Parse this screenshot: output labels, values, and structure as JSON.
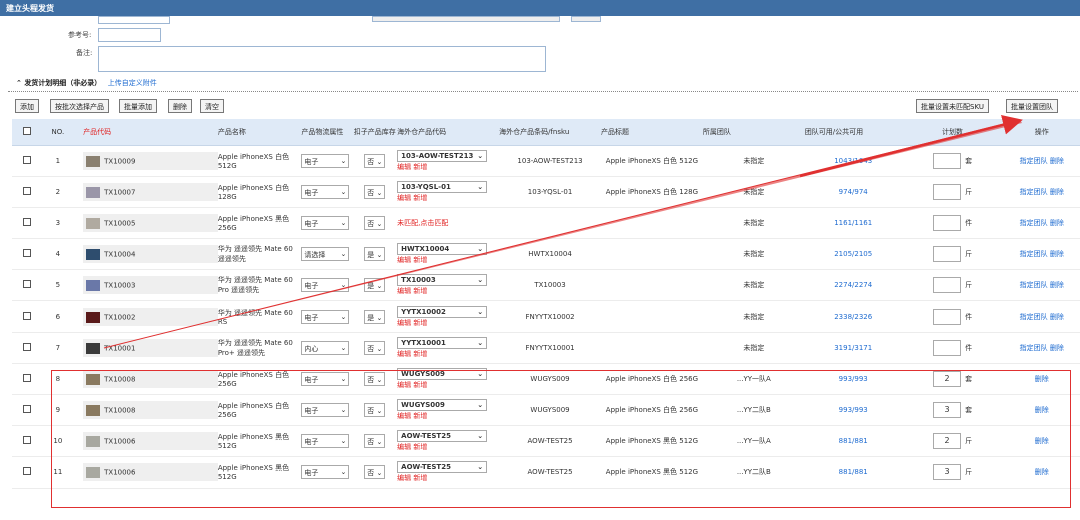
{
  "window": {
    "title": "建立头程发货"
  },
  "form": {
    "ref_label": "参考号:",
    "remark_label": "备注:"
  },
  "section": {
    "title": "发货计划明细（非必录）",
    "upload_link": "上传自定义附件"
  },
  "toolbar": {
    "add": "添加",
    "by_batch": "按批次选择产品",
    "batch_add": "批量添加",
    "delete": "删除",
    "clear": "清空",
    "batch_unmatched_sku": "批量设置未匹配SKU",
    "batch_team": "批量设置团队"
  },
  "table": {
    "headers": [
      "NO.",
      "产品代码",
      "产品名称",
      "产品物流属性",
      "扣子产品库存",
      "海外仓产品代码",
      "海外仓产品条码/fnsku",
      "产品标题",
      "所属团队",
      "团队可用/公共可用",
      "计划数",
      "操作"
    ],
    "edit_label": "编辑",
    "new_label": "新增",
    "rows": [
      {
        "no": "1",
        "code": "TX10009",
        "name": "Apple iPhoneXS 白色 512G",
        "logistics": "电子",
        "stock": "否",
        "wh_code": "103-AOW-TEST213",
        "wh_barcode": "103-AOW-TEST213",
        "title": "Apple iPhoneXS 白色 512G",
        "team": "未指定",
        "avail": "1043/1043",
        "qty": "",
        "unit": "套",
        "op1": "指定团队",
        "op2": "删除",
        "thumb": "#8a8070"
      },
      {
        "no": "2",
        "code": "TX10007",
        "name": "Apple iPhoneXS 白色 128G",
        "logistics": "电子",
        "stock": "否",
        "wh_code": "103-YQSL-01",
        "wh_barcode": "103-YQSL-01",
        "title": "Apple iPhoneXS 白色 128G",
        "team": "未指定",
        "avail": "974/974",
        "qty": "",
        "unit": "斤",
        "op1": "指定团队",
        "op2": "删除",
        "thumb": "#9a96a8"
      },
      {
        "no": "3",
        "code": "TX10005",
        "name": "Apple iPhoneXS 黑色 256G",
        "logistics": "电子",
        "stock": "否",
        "wh_code": "",
        "wh_barcode": "",
        "title": "",
        "team": "未指定",
        "avail": "1161/1161",
        "qty": "",
        "unit": "件",
        "op1": "指定团队",
        "op2": "删除",
        "thumb": "#b0aaa0",
        "unmatched": "未匹配,点击匹配"
      },
      {
        "no": "4",
        "code": "TX10004",
        "name": "华为 遥遥领先 Mate 60 遥遥领先",
        "logistics": "请选择",
        "stock": "是",
        "wh_code": "HWTX10004",
        "wh_barcode": "HWTX10004",
        "title": "",
        "team": "未指定",
        "avail": "2105/2105",
        "qty": "",
        "unit": "斤",
        "op1": "指定团队",
        "op2": "删除",
        "thumb": "#2e4d6e"
      },
      {
        "no": "5",
        "code": "TX10003",
        "name": "华为 遥遥领先 Mate 60 Pro 遥遥领先",
        "logistics": "电子",
        "stock": "是",
        "wh_code": "TX10003",
        "wh_barcode": "TX10003",
        "title": "",
        "team": "未指定",
        "avail": "2274/2274",
        "qty": "",
        "unit": "斤",
        "op1": "指定团队",
        "op2": "删除",
        "thumb": "#6a78a8"
      },
      {
        "no": "6",
        "code": "TX10002",
        "name": "华为 遥遥领先 Mate 60 RS",
        "logistics": "电子",
        "stock": "是",
        "wh_code": "YYTX10002",
        "wh_barcode": "FNYYTX10002",
        "title": "",
        "team": "未指定",
        "avail": "2338/2326",
        "qty": "",
        "unit": "件",
        "op1": "指定团队",
        "op2": "删除",
        "thumb": "#5a1a1a"
      },
      {
        "no": "7",
        "code": "TX10001",
        "name": "华为 遥遥领先 Mate 60 Pro+ 遥遥领先",
        "logistics": "内心",
        "stock": "否",
        "wh_code": "YYTX10001",
        "wh_barcode": "FNYYTX10001",
        "title": "",
        "team": "未指定",
        "avail": "3191/3171",
        "qty": "",
        "unit": "件",
        "op1": "指定团队",
        "op2": "删除",
        "thumb": "#3a3a3a"
      },
      {
        "no": "8",
        "code": "TX10008",
        "name": "Apple iPhoneXS 白色 256G",
        "logistics": "电子",
        "stock": "否",
        "wh_code": "WUGYS009",
        "wh_barcode": "WUGYS009",
        "title": "Apple iPhoneXS 白色 256G",
        "team": "...YY一队A",
        "avail": "993/993",
        "qty": "2",
        "unit": "套",
        "op1": "",
        "op2": "删除",
        "thumb": "#8a7a60"
      },
      {
        "no": "9",
        "code": "TX10008",
        "name": "Apple iPhoneXS 白色 256G",
        "logistics": "电子",
        "stock": "否",
        "wh_code": "WUGYS009",
        "wh_barcode": "WUGYS009",
        "title": "Apple iPhoneXS 白色 256G",
        "team": "...YY二队B",
        "avail": "993/993",
        "qty": "3",
        "unit": "套",
        "op1": "",
        "op2": "删除",
        "thumb": "#8a7a60"
      },
      {
        "no": "10",
        "code": "TX10006",
        "name": "Apple iPhoneXS 黑色 512G",
        "logistics": "电子",
        "stock": "否",
        "wh_code": "AOW-TEST25",
        "wh_barcode": "AOW-TEST25",
        "title": "Apple iPhoneXS 黑色 512G",
        "team": "...YY一队A",
        "avail": "881/881",
        "qty": "2",
        "unit": "斤",
        "op1": "",
        "op2": "删除",
        "thumb": "#a8a8a0"
      },
      {
        "no": "11",
        "code": "TX10006",
        "name": "Apple iPhoneXS 黑色 512G",
        "logistics": "电子",
        "stock": "否",
        "wh_code": "AOW-TEST25",
        "wh_barcode": "AOW-TEST25",
        "title": "Apple iPhoneXS 黑色 512G",
        "team": "...YY二队B",
        "avail": "881/881",
        "qty": "3",
        "unit": "斤",
        "op1": "",
        "op2": "删除",
        "thumb": "#a8a8a0"
      }
    ]
  },
  "annotation": {
    "color": "#e03030"
  }
}
